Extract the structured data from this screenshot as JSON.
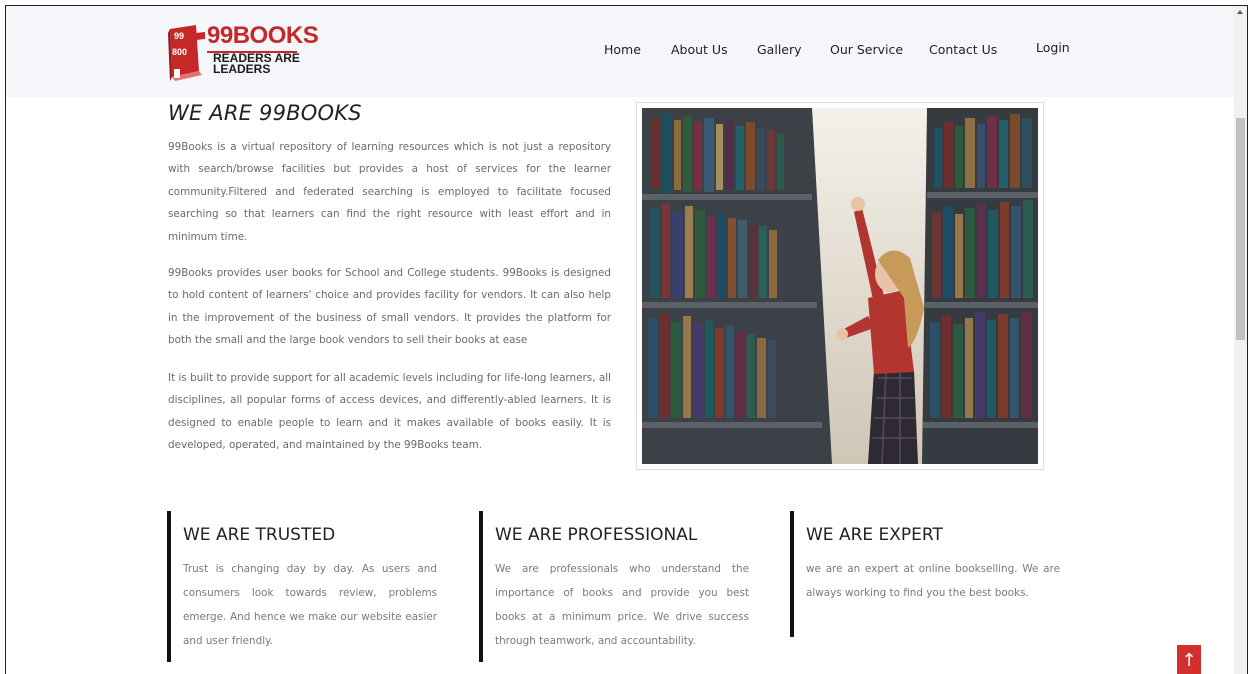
{
  "brand": {
    "logo_name": "99BOOKS",
    "logo_tagline": "READERS ARE LEADERS",
    "logo_badge_top": "99",
    "logo_badge_bottom": "800",
    "accent_color": "#c62828"
  },
  "nav": {
    "items": [
      {
        "label": "Home"
      },
      {
        "label": "About Us"
      },
      {
        "label": "Gallery"
      },
      {
        "label": "Our Service"
      },
      {
        "label": "Contact Us"
      },
      {
        "label": "Login"
      }
    ]
  },
  "about": {
    "title": "WE ARE 99BOOKS",
    "paragraphs": [
      "99Books is a virtual repository of learning resources which is not just a repository with search/browse facilities but provides a host of services for the learner community.Filtered and federated searching is employed to facilitate focused searching so that learners can find the right resource with least effort and in minimum time.",
      "99Books provides user books for School and College students. 99Books is designed to hold content of learners' choice and provides facility for vendors. It can also help in the improvement of the business of small vendors. It provides the platform for both the small and the large book vendors to sell their books at ease",
      "It is built to provide support for all academic levels including for life-long learners, all disciplines, all popular forms of access devices, and differently-abled learners. It is designed to enable people to learn and it makes available of books easily. It is developed, operated, and maintained by the 99Books team."
    ]
  },
  "features": [
    {
      "title": "WE ARE TRUSTED",
      "text": "Trust is changing day by day. As users and consumers look towards review, problems emerge. And hence we make our website easier and user friendly."
    },
    {
      "title": "WE ARE PROFESSIONAL",
      "text": "We are professionals who understand the importance of books and provide you best books at a minimum price. We drive success through teamwork, and accountability."
    },
    {
      "title": "WE ARE EXPERT",
      "text": "we are an expert at online bookselling. We are always working to find you the best books."
    }
  ],
  "back_to_top": {
    "icon": "arrow-up-icon",
    "glyph": "↑",
    "color": "#d32f2f"
  }
}
